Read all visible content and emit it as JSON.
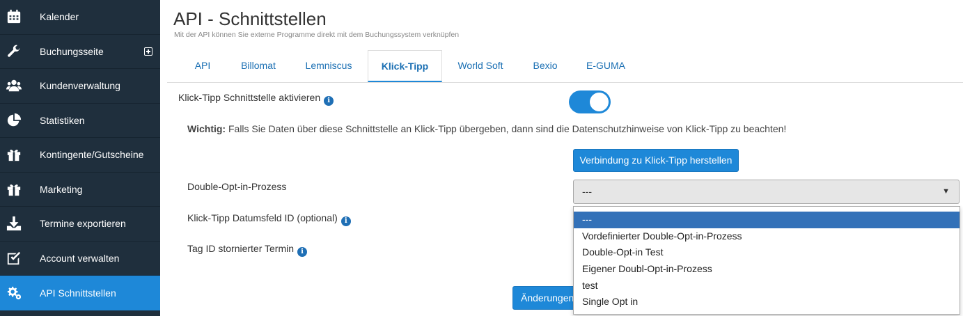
{
  "sidebar": {
    "items": [
      {
        "label": "Kalender",
        "icon": "calendar-icon"
      },
      {
        "label": "Buchungsseite",
        "icon": "wrench-icon"
      },
      {
        "label": "Kundenverwaltung",
        "icon": "users-icon"
      },
      {
        "label": "Statistiken",
        "icon": "pie-chart-icon"
      },
      {
        "label": "Kontingente/Gutscheine",
        "icon": "gift-icon"
      },
      {
        "label": "Marketing",
        "icon": "gift-icon"
      },
      {
        "label": "Termine exportieren",
        "icon": "download-icon"
      },
      {
        "label": "Account verwalten",
        "icon": "checkbox-icon"
      },
      {
        "label": "API Schnittstellen",
        "icon": "gears-icon"
      }
    ]
  },
  "header": {
    "title": "API - Schnittstellen",
    "subtitle": "Mit der API können Sie externe Programme direkt mit dem Buchungssystem verknüpfen"
  },
  "tabs": [
    "API",
    "Billomat",
    "Lemniscus",
    "Klick-Tipp",
    "World Soft",
    "Bexio",
    "E-GUMA"
  ],
  "form": {
    "activate_label": "Klick-Tipp Schnittstelle aktivieren",
    "activate_on": true,
    "notice_bold": "Wichtig:",
    "notice_text": " Falls Sie Daten über diese Schnittstelle an Klick-Tipp übergeben, dann sind die Datenschutzhinweise von Klick-Tipp zu beachten!",
    "connect_button": "Verbindung zu Klick-Tipp herstellen",
    "doi_label": "Double-Opt-in-Prozess",
    "doi_selected": "---",
    "doi_options": [
      "---",
      "Vordefinierter Double-Opt-in-Prozess",
      "Double-Opt-in Test",
      "Eigener Doubl-Opt-in-Prozess",
      "test",
      "Single Opt in"
    ],
    "date_field_label": "Klick-Tipp Datumsfeld ID (optional)",
    "cancel_tag_label": "Tag ID stornierter Termin",
    "save_button": "Änderungen speichern"
  },
  "colors": {
    "sidebar_bg": "#1f2f3d",
    "accent": "#1e88d8",
    "link": "#1a6fb3"
  }
}
